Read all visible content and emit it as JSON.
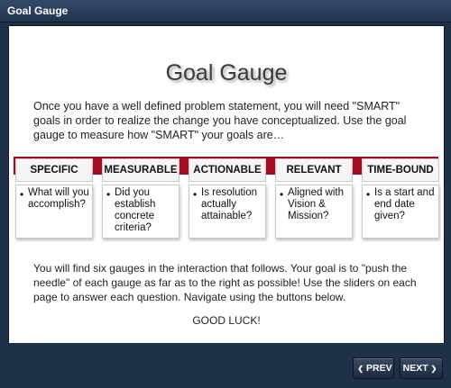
{
  "window": {
    "title": "Goal Gauge"
  },
  "page": {
    "heading": "Goal Gauge",
    "intro": "Once you have a well defined problem statement, you will need \"SMART\" goals in order to realize the change you have conceptualized. Use the goal gauge to measure how \"SMART\" your goals are…",
    "outro": "You will find six gauges in the interaction that follows. Your goal is to \"push the needle\" of each gauge as far as to the right as possible! Use the sliders on each page to answer each question. Navigate using the buttons below.",
    "good_luck": "GOOD LUCK!"
  },
  "cards": [
    {
      "title": "SPECIFIC",
      "text": "What will you accomplish?"
    },
    {
      "title": "MEASURABLE",
      "text": "Did you establish concrete criteria?"
    },
    {
      "title": "ACTIONABLE",
      "text": "Is resolution actually attainable?"
    },
    {
      "title": "RELEVANT",
      "text": "Aligned with Vision & Mission?"
    },
    {
      "title": "TIME-BOUND",
      "text": "Is a start and end date given?"
    }
  ],
  "bullet_char": "•",
  "nav": {
    "prev_label": "PREV",
    "next_label": "NEXT",
    "prev_icon": "❮",
    "next_icon": "❯"
  },
  "colors": {
    "accent_bar": "#a50d1e",
    "frame": "#1f3049"
  }
}
